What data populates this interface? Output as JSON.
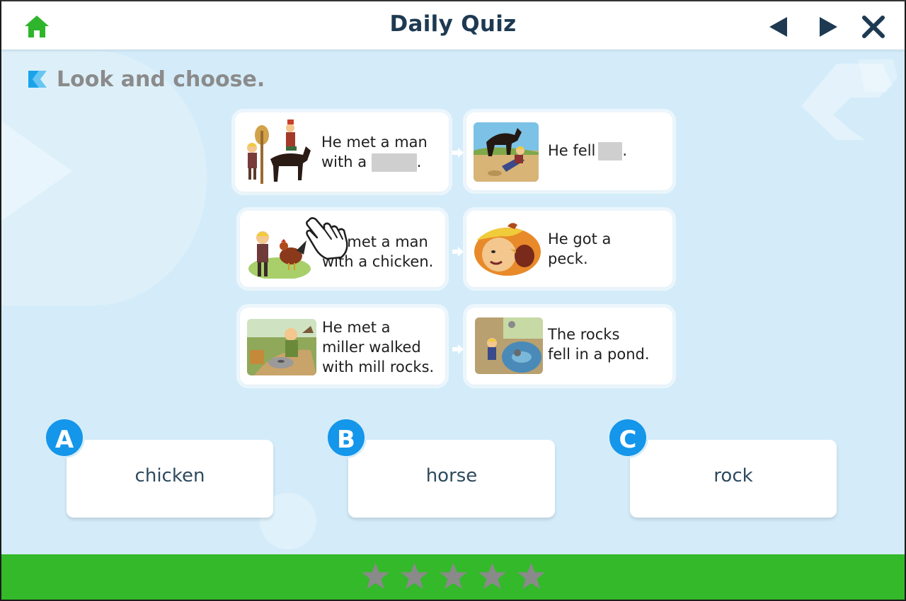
{
  "header": {
    "title": "Daily Quiz",
    "icons": {
      "home": "home-icon",
      "prev": "triangle-left-icon",
      "next": "triangle-right-icon",
      "close": "close-icon"
    }
  },
  "instruction": {
    "text": "Look and choose.",
    "icon": "k-bookmark-icon"
  },
  "story": {
    "rows": [
      {
        "left": {
          "line1": "He met a man",
          "line2_prefix": "with a",
          "line2_suffix": "."
        },
        "right": {
          "prefix": "He fell",
          "suffix": "."
        }
      },
      {
        "left": {
          "line1": "He met a man",
          "line2": "with a chicken."
        },
        "right": {
          "line1": "He got a",
          "line2": "peck."
        }
      },
      {
        "left": {
          "line1": "He met a",
          "line2": "miller walked",
          "line3": "with mill rocks."
        },
        "right": {
          "line1": "The rocks",
          "line2": "fell in a pond."
        }
      }
    ]
  },
  "options": [
    {
      "letter": "A",
      "label": "chicken"
    },
    {
      "letter": "B",
      "label": "horse"
    },
    {
      "letter": "C",
      "label": "rock"
    }
  ],
  "progress": {
    "stars_total": 5,
    "stars_earned": 0
  },
  "colors": {
    "accent_blue": "#1496ea",
    "home_green": "#2fb52b",
    "bottom_bar": "#33b92a",
    "background": "#d4ecf9",
    "star_grey": "#8a8a8a"
  }
}
